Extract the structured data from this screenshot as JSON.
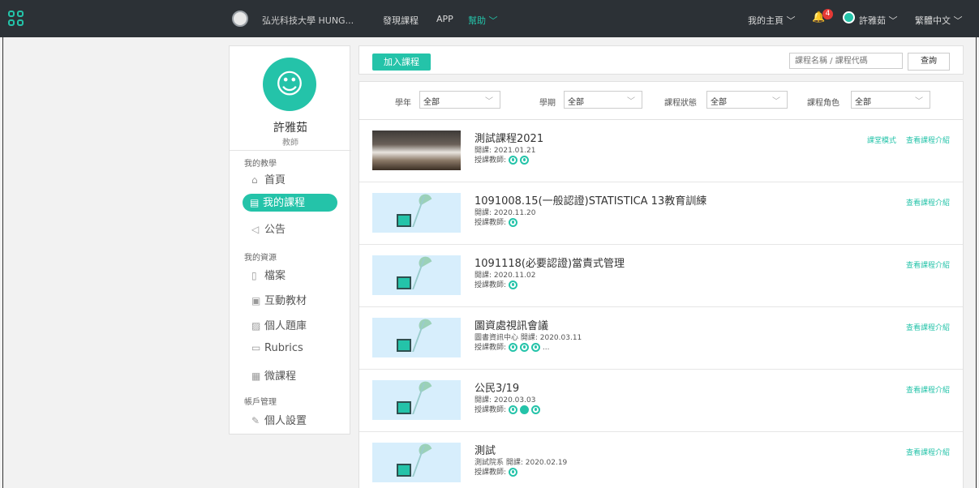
{
  "topbar": {
    "school": "弘光科技大學 HUNG...",
    "discover": "發現課程",
    "app": "APP",
    "help": "幫助 ﹀",
    "home": "我的主頁 ﹀",
    "bell_count": "4",
    "user": "許雅茹 ﹀",
    "language": "繁體中文 ﹀"
  },
  "sidebar": {
    "name": "許雅茹",
    "role": "教師",
    "sections": {
      "teaching": "我的教學",
      "resources": "我的資源",
      "account": "帳戶管理"
    },
    "items": {
      "home": "首頁",
      "courses": "我的課程",
      "announcements": "公告",
      "files": "檔案",
      "interactive": "互動教材",
      "question_bank": "個人題庫",
      "rubrics": "Rubrics",
      "micro": "微課程",
      "settings": "個人設置"
    }
  },
  "toolbar": {
    "add_course": "加入課程",
    "search_placeholder": "課程名稱 / 課程代碼",
    "search_button": "查詢"
  },
  "filters": {
    "year_label": "學年",
    "year_value": "全部",
    "semester_label": "學期",
    "semester_value": "全部",
    "status_label": "課程狀態",
    "status_value": "全部",
    "role_label": "課程角色",
    "role_value": "全部"
  },
  "courses": [
    {
      "title": "測試課程2021",
      "meta": "開課: 2021.01.21",
      "teachers_label": "授課教師:",
      "links": [
        "課堂模式",
        "查看課程介紹"
      ]
    },
    {
      "title": "1091008.15(一般認證)STATISTICA 13教育訓練",
      "meta": "開課: 2020.11.20",
      "teachers_label": "授課教師:",
      "links": [
        "查看課程介紹"
      ]
    },
    {
      "title": "1091118(必要認證)當責式管理",
      "meta": "開課: 2020.11.02",
      "teachers_label": "授課教師:",
      "links": [
        "查看課程介紹"
      ]
    },
    {
      "title": "圖資處視訊會議",
      "meta": "圖書資訊中心   開課: 2020.03.11",
      "teachers_label": "授課教師:",
      "more": "...",
      "links": [
        "查看課程介紹"
      ]
    },
    {
      "title": "公民3/19",
      "meta": "開課: 2020.03.03",
      "teachers_label": "授課教師:",
      "links": [
        "查看課程介紹"
      ]
    },
    {
      "title": "測試",
      "meta": "測試院系   開課: 2020.02.19",
      "teachers_label": "授課教師:",
      "links": [
        "查看課程介紹"
      ]
    }
  ]
}
